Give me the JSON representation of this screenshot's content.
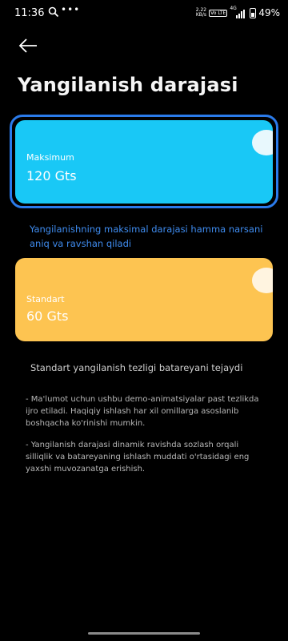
{
  "status_bar": {
    "time": "11:36",
    "net_speed_value": "2.22",
    "net_speed_unit": "KB/s",
    "volte_badge": "Vo LTE",
    "signal_type": "4G",
    "battery_percent": "49%",
    "battery_level": 0.49
  },
  "header": {
    "back_icon": "arrow-left-icon",
    "title": "Yangilanish darajasi"
  },
  "options": [
    {
      "id": "max",
      "label": "Maksimum",
      "value": "120 Gts",
      "selected": true,
      "color": "#19c8f6",
      "description": "Yangilanishning maksimal darajasi hamma narsani aniq va ravshan qiladi"
    },
    {
      "id": "standard",
      "label": "Standart",
      "value": "60 Gts",
      "selected": false,
      "color": "#fdc451",
      "description": "Standart yangilanish tezligi batareyani tejaydi"
    }
  ],
  "notes": [
    "- Ma'lumot uchun ushbu demo-animatsiyalar past tezlikda ijro etiladi. Haqiqiy ishlash har xil omillarga asoslanib boshqacha ko'rinishi mumkin.",
    "- Yangilanish darajasi dinamik ravishda sozlash orqali silliqlik va batareyaning ishlash muddati o'rtasidagi eng yaxshi muvozanatga erishish."
  ],
  "colors": {
    "selected_outline": "#2b7bea",
    "selected_description": "#3f8cf0"
  }
}
